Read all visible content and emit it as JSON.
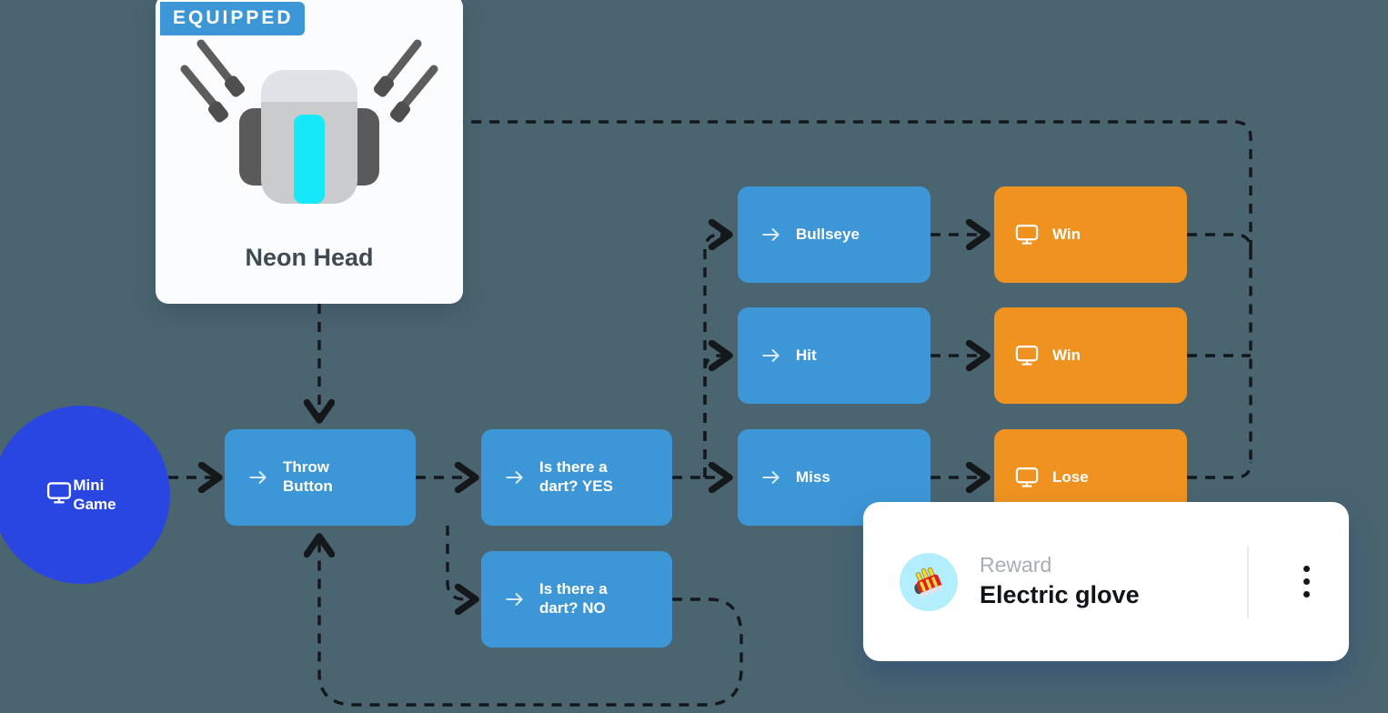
{
  "equipped_card": {
    "badge": "EQUIPPED",
    "name": "Neon Head",
    "art_icon": "robot-head-icon",
    "accent": "#3d96d6"
  },
  "start_node": {
    "label": "Mini\nGame",
    "icon": "monitor-icon",
    "color": "#2a46e0"
  },
  "nodes": [
    {
      "id": "throw",
      "label": "Throw\nButton",
      "icon": "arrow-right-icon",
      "type": "blue",
      "color": "#3d96d6"
    },
    {
      "id": "dart_yes",
      "label": "Is there a\ndart? YES",
      "icon": "arrow-right-icon",
      "type": "blue",
      "color": "#3d96d6"
    },
    {
      "id": "dart_no",
      "label": "Is there a\ndart? NO",
      "icon": "arrow-right-icon",
      "type": "blue",
      "color": "#3d96d6"
    },
    {
      "id": "bullseye",
      "label": "Bullseye",
      "icon": "arrow-right-icon",
      "type": "blue",
      "color": "#3d96d6"
    },
    {
      "id": "hit",
      "label": "Hit",
      "icon": "arrow-right-icon",
      "type": "blue",
      "color": "#3d96d6"
    },
    {
      "id": "miss",
      "label": "Miss",
      "icon": "arrow-right-icon",
      "type": "blue",
      "color": "#3d96d6"
    },
    {
      "id": "win_top",
      "label": "Win",
      "icon": "monitor-icon",
      "type": "orange",
      "color": "#f0921f"
    },
    {
      "id": "win_mid",
      "label": "Win",
      "icon": "monitor-icon",
      "type": "orange",
      "color": "#f0921f"
    },
    {
      "id": "lose",
      "label": "Lose",
      "icon": "monitor-icon",
      "type": "orange",
      "color": "#f0921f"
    }
  ],
  "reward_card": {
    "label": "Reward",
    "value": "Electric glove",
    "avatar_icon": "electric-glove-icon",
    "menu_icon": "kebab-menu-icon",
    "avatar_bg": "#b2eefb"
  },
  "canvas": {
    "background": "#4a6470",
    "edge_color": "#15181b",
    "edge_style": "dashed"
  }
}
